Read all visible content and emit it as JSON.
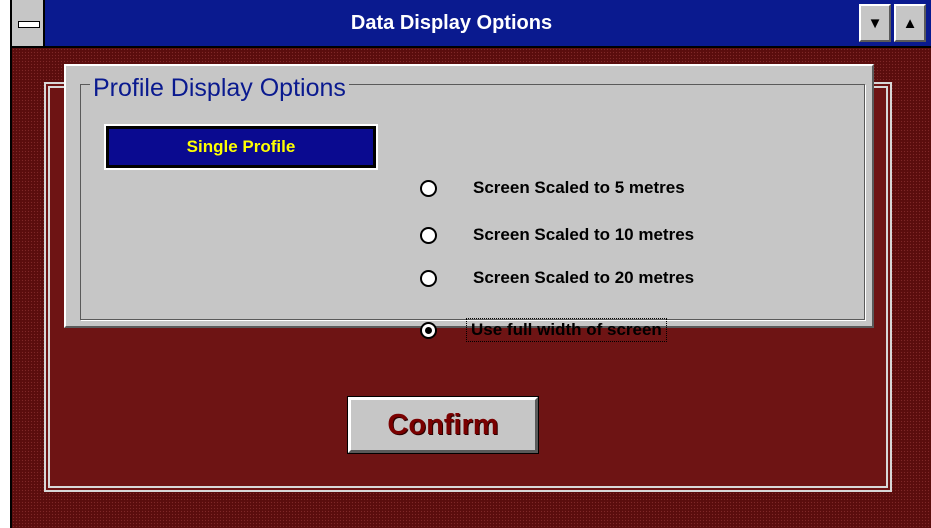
{
  "window": {
    "title": "Data Display Options",
    "scroll_down_glyph": "▼",
    "scroll_up_glyph": "▲"
  },
  "group": {
    "label": "Profile Display Options"
  },
  "profile_button": {
    "label": "Single Profile"
  },
  "radios": [
    {
      "label": "Screen Scaled to 5 metres",
      "selected": false
    },
    {
      "label": "Screen Scaled to 10 metres",
      "selected": false
    },
    {
      "label": "Screen Scaled to 20 metres",
      "selected": false
    },
    {
      "label": "Use full width of screen",
      "selected": true
    }
  ],
  "confirm": {
    "label": "Confirm"
  },
  "colors": {
    "titlebar": "#0a1a8f",
    "background": "#5a0d0d",
    "panel": "#c6c6c6",
    "profile_button_bg": "#0a0a90",
    "profile_button_text": "#ffff00",
    "confirm_text": "#7a0000"
  },
  "icons": {
    "system_menu": "system-menu-icon",
    "minimize": "arrow-down-icon",
    "maximize": "arrow-up-icon"
  }
}
